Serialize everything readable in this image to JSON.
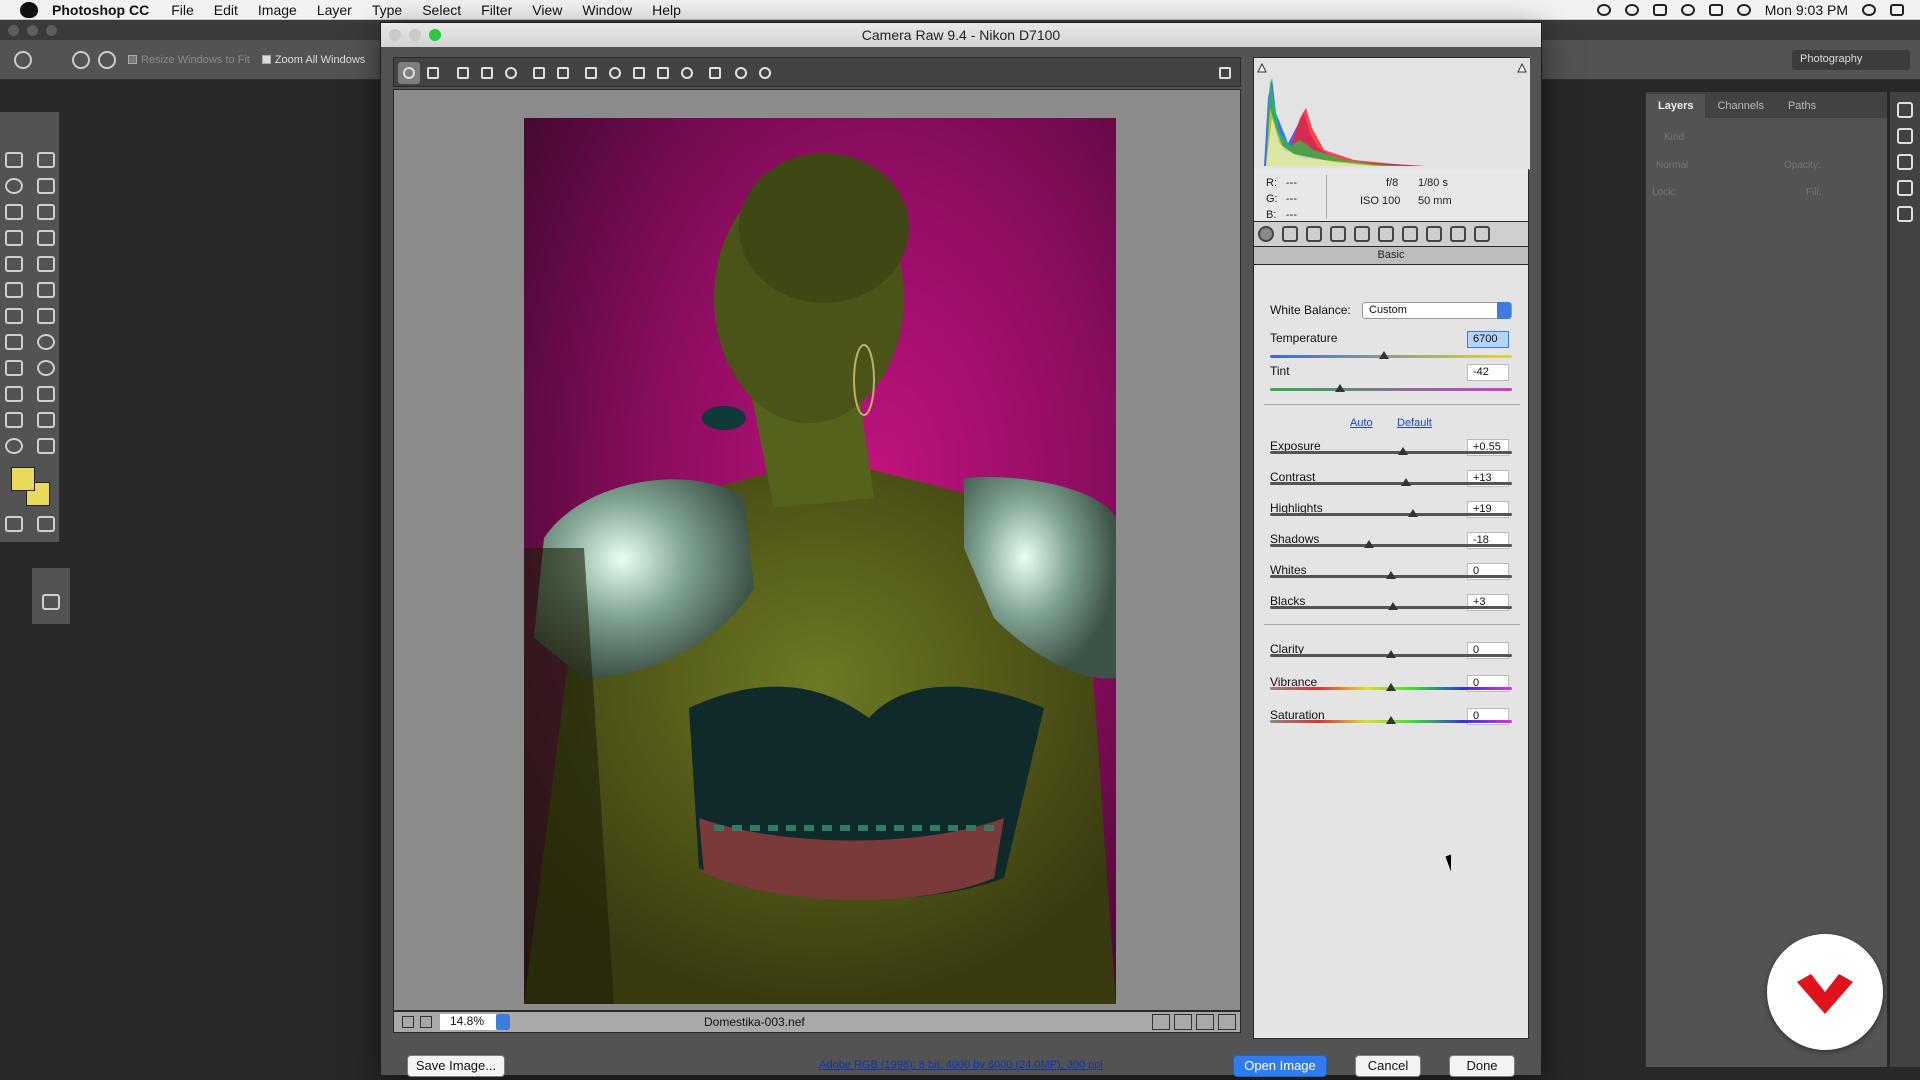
{
  "menubar": {
    "app_name": "Photoshop CC",
    "items": [
      "File",
      "Edit",
      "Image",
      "Layer",
      "Type",
      "Select",
      "Filter",
      "View",
      "Window",
      "Help"
    ],
    "clock": "Mon 9:03 PM"
  },
  "options_bar": {
    "resize_label": "Resize Windows to Fit",
    "zoom_all_label": "Zoom All Windows",
    "workspace": "Photography"
  },
  "side_panel": {
    "tabs": [
      "Layers",
      "Channels",
      "Paths"
    ],
    "kind_label": "Kind",
    "blend_mode": "Normal",
    "opacity_label": "Opacity:",
    "lock_label": "Lock:",
    "fill_label": "Fill:"
  },
  "camera_raw": {
    "title": "Camera Raw 9.4  -  Nikon D7100",
    "zoom": "14.8%",
    "filename": "Domestika-003.nef",
    "exif": {
      "r_label": "R:",
      "g_label": "G:",
      "b_label": "B:",
      "r": "---",
      "g": "---",
      "b": "---",
      "aperture": "f/8",
      "shutter": "1/80 s",
      "iso": "ISO 100",
      "focal": "50 mm"
    },
    "panel_title": "Basic",
    "white_balance_label": "White Balance:",
    "white_balance_value": "Custom",
    "auto_label": "Auto",
    "default_label": "Default",
    "temperature": {
      "label": "Temperature",
      "value": "6700",
      "position": 0.47
    },
    "tint": {
      "label": "Tint",
      "value": "-42",
      "position": 0.29
    },
    "exposure": {
      "label": "Exposure",
      "value": "+0.55",
      "position": 0.55
    },
    "contrast": {
      "label": "Contrast",
      "value": "+13",
      "position": 0.56
    },
    "highlights": {
      "label": "Highlights",
      "value": "+19",
      "position": 0.59
    },
    "shadows": {
      "label": "Shadows",
      "value": "-18",
      "position": 0.41
    },
    "whites": {
      "label": "Whites",
      "value": "0",
      "position": 0.5
    },
    "blacks": {
      "label": "Blacks",
      "value": "+3",
      "position": 0.51
    },
    "clarity": {
      "label": "Clarity",
      "value": "0",
      "position": 0.5
    },
    "vibrance": {
      "label": "Vibrance",
      "value": "0",
      "position": 0.5
    },
    "saturation": {
      "label": "Saturation",
      "value": "0",
      "position": 0.5
    },
    "save_label": "Save Image...",
    "workflow_info": "Adobe RGB (1998); 8 bit; 4000 by 6000 (24.0MP); 300 ppi",
    "open_label": "Open Image",
    "cancel_label": "Cancel",
    "done_label": "Done"
  },
  "colors": {
    "accent": "#2f7cf0",
    "foreground_swatch": "#e9da5b",
    "logo_red": "#e0121c"
  }
}
